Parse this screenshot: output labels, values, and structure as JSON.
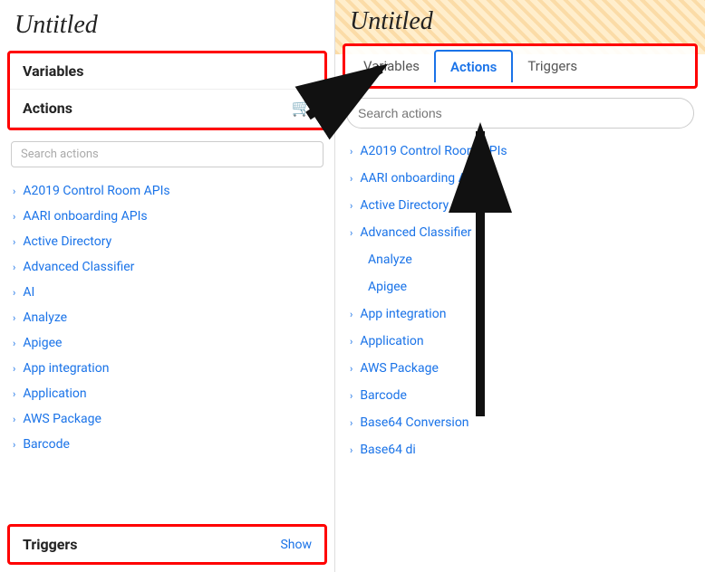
{
  "left": {
    "title": "Untitled",
    "variables_label": "Variables",
    "actions_label": "Actions",
    "search_placeholder": "Search actions",
    "action_items": [
      "A2019 Control Room APIs",
      "AARI onboarding APIs",
      "Active Directory",
      "Advanced Classifier",
      "AI",
      "Analyze",
      "Apigee",
      "App integration",
      "Application",
      "AWS Package",
      "Barcode"
    ],
    "triggers_label": "Triggers",
    "show_label": "Show"
  },
  "right": {
    "title": "Untitled",
    "tabs": [
      {
        "label": "Variables",
        "active": false
      },
      {
        "label": "Actions",
        "active": true
      },
      {
        "label": "Triggers",
        "active": false
      }
    ],
    "search_placeholder": "Search actions",
    "action_items": [
      {
        "label": "A2019 Control Room APIs",
        "chevron": true
      },
      {
        "label": "AARI onboarding APIs",
        "chevron": true
      },
      {
        "label": "Active Directory",
        "chevron": true
      },
      {
        "label": "Advanced Classifier",
        "chevron": true
      },
      {
        "label": "Analyze",
        "chevron": false
      },
      {
        "label": "Apigee",
        "chevron": false
      },
      {
        "label": "App integration",
        "chevron": true
      },
      {
        "label": "Application",
        "chevron": true
      },
      {
        "label": "AWS Package",
        "chevron": true
      },
      {
        "label": "Barcode",
        "chevron": true
      },
      {
        "label": "Base64 Conversion",
        "chevron": true
      },
      {
        "label": "Base64 di",
        "chevron": true
      }
    ]
  }
}
